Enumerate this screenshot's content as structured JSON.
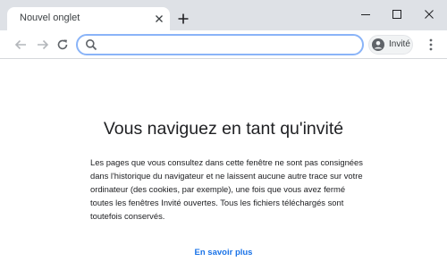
{
  "tab": {
    "title": "Nouvel onglet"
  },
  "toolbar": {
    "omnibox_value": "",
    "guest_label": "Invité"
  },
  "content": {
    "heading": "Vous naviguez en tant qu'invité",
    "body": "Les pages que vous consultez dans cette fenêtre ne sont pas consignées dans l'historique du navigateur et ne laissent aucune autre trace sur votre ordinateur (des cookies, par exemple), une fois que vous avez fermé toutes les fenêtres Invité ouvertes. Tous les fichiers téléchargés sont toutefois conservés.",
    "learn_more": "En savoir plus"
  },
  "colors": {
    "tab_strip": "#dee1e6",
    "link": "#1a73e8",
    "omnibox_focus": "#8ab4f8"
  },
  "icons": [
    "close-icon",
    "plus-icon",
    "minimize-icon",
    "maximize-icon",
    "window-close-icon",
    "arrow-left-icon",
    "arrow-right-icon",
    "reload-icon",
    "search-icon",
    "guest-avatar-icon",
    "vertical-dots-icon"
  ]
}
